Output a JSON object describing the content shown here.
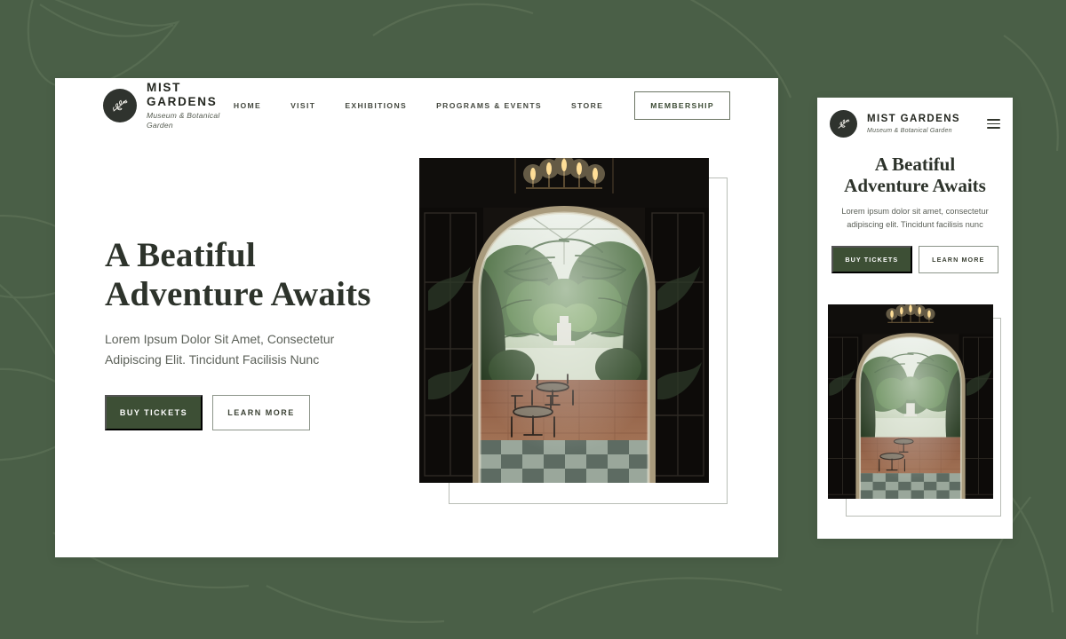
{
  "theme": {
    "background_green": "#4a5f47",
    "button_green": "#3d4f35",
    "logo_circle": "#2f332e",
    "heading_color": "#2d332b",
    "body_text_color": "#5c6159"
  },
  "brand": {
    "name": "MIST GARDENS",
    "tagline": "Museum & Botanical Garden",
    "logo_icon": "botanical-sprig-icon"
  },
  "desktop": {
    "nav": [
      {
        "label": "HOME"
      },
      {
        "label": "VISIT"
      },
      {
        "label": "EXHIBITIONS"
      },
      {
        "label": "PROGRAMS & EVENTS"
      },
      {
        "label": "STORE"
      }
    ],
    "nav_cta": "MEMBERSHIP",
    "hero": {
      "title_line1": "A Beatiful",
      "title_line2": "Adventure Awaits",
      "subtitle": "Lorem Ipsum Dolor Sit Amet, Consectetur Adipiscing Elit. Tincidunt Facilisis Nunc",
      "primary_button": "BUY TICKETS",
      "secondary_button": "LEARN MORE",
      "image_alt": "Archway view into a lush conservatory courtyard with chandelier, palms and bistro tables"
    }
  },
  "mobile": {
    "menu_icon": "hamburger-menu-icon",
    "hero": {
      "title_line1": "A Beatiful",
      "title_line2": "Adventure Awaits",
      "subtitle": "Lorem ipsum dolor sit amet, consectetur adipiscing elit. Tincidunt facilisis nunc",
      "primary_button": "BUY TICKETS",
      "secondary_button": "LEARN MORE",
      "image_alt": "Archway view into a lush conservatory courtyard with chandelier, palms and bistro tables"
    }
  }
}
